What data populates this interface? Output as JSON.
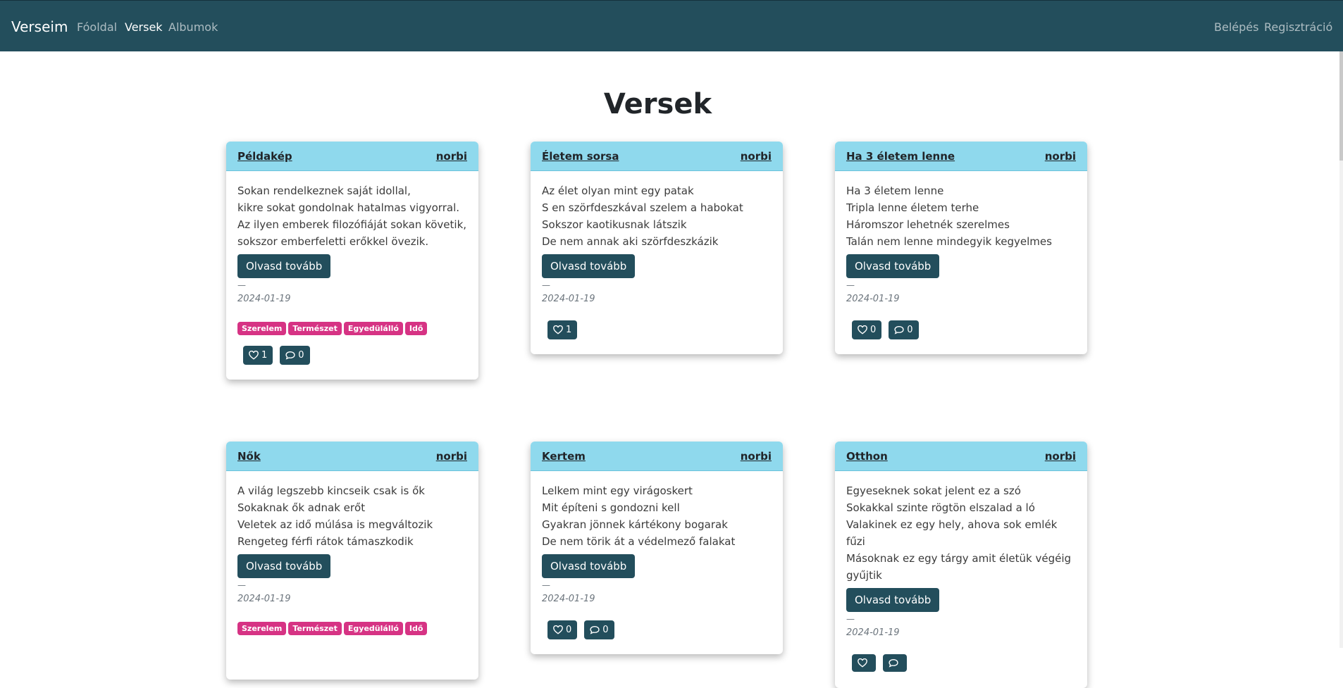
{
  "nav": {
    "brand": "Verseim",
    "links": [
      "Fóoldal",
      "Versek",
      "Albumok"
    ],
    "active_index": 1,
    "right_links": [
      "Belépés",
      "Regisztráció"
    ]
  },
  "page_title": "Versek",
  "read_more_label": "Olvasd tovább",
  "dash": "—",
  "colors": {
    "navbar": "#234e5c",
    "card_header": "#8fd9ed",
    "tag": "#d63384"
  },
  "cards": [
    {
      "title": "Példakép",
      "author": "norbi",
      "lines": [
        "Sokan rendelkeznek saját idollal,",
        "kikre sokat gondolnak hatalmas vigyorral.",
        "Az ilyen emberek filozófiáját sokan követik,",
        "sokszor emberfeletti erőkkel övezik."
      ],
      "date": "2024-01-19",
      "tags": [
        "Szerelem",
        "Természet",
        "Egyedülálló",
        "Idő"
      ],
      "likes": "1",
      "comments": "0"
    },
    {
      "title": "Életem sorsa",
      "author": "norbi",
      "lines": [
        "Az élet olyan mint egy patak",
        "S en szörfdeszkával szelem a habokat",
        "Sokszor kaotikusnak látszik",
        "De nem annak aki szörfdeszkázik"
      ],
      "date": "2024-01-19",
      "tags": [],
      "likes": "1",
      "comments": null
    },
    {
      "title": "Ha 3 életem lenne",
      "author": "norbi",
      "lines": [
        "Ha 3 életem lenne",
        "Tripla lenne életem terhe",
        "Háromszor lehetnék szerelmes",
        "Talán nem lenne mindegyik kegyelmes"
      ],
      "date": "2024-01-19",
      "tags": [],
      "likes": "0",
      "comments": "0"
    },
    {
      "title": "Nők",
      "author": "norbi",
      "lines": [
        "A világ legszebb kincseik csak is ők",
        "Sokaknak ők adnak erőt",
        "Veletek az idő múlása is megváltozik",
        "Rengeteg férfi rátok támaszkodik"
      ],
      "date": "2024-01-19",
      "tags": [
        "Szerelem",
        "Természet",
        "Egyedülálló",
        "Idő"
      ],
      "likes": null,
      "comments": null
    },
    {
      "title": "Kertem",
      "author": "norbi",
      "lines": [
        "Lelkem mint egy virágoskert",
        "Mit építeni s gondozni kell",
        "Gyakran jönnek kártékony bogarak",
        "De nem törik át a védelmező falakat"
      ],
      "date": "2024-01-19",
      "tags": [],
      "likes": "0",
      "comments": "0"
    },
    {
      "title": "Otthon",
      "author": "norbi",
      "lines": [
        "Egyeseknek sokat jelent ez a szó",
        "Sokakkal szinte rögtön elszalad a ló",
        "Valakinek ez egy hely, ahova sok emlék fűzi",
        "Másoknak ez egy tárgy amit életük végéig",
        "gyűjtik"
      ],
      "date": "2024-01-19",
      "tags": [],
      "likes": "",
      "comments": ""
    }
  ]
}
